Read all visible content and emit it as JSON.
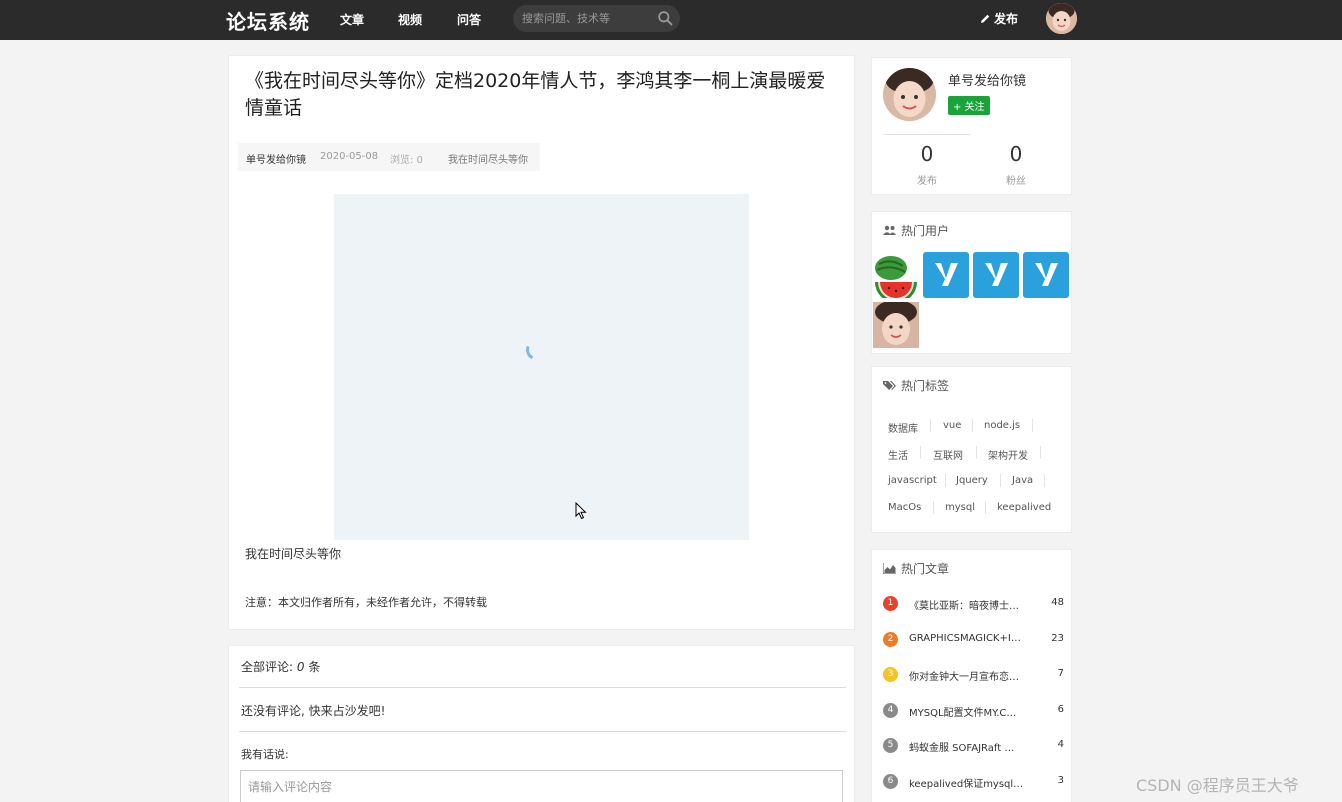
{
  "header": {
    "logo": "论坛系统",
    "nav": [
      "文章",
      "视频",
      "问答"
    ],
    "search_placeholder": "搜索问题、技术等",
    "publish_label": "发布"
  },
  "article": {
    "title": "《我在时间尽头等你》定档2020年情人节，李鸿其李一桐上演最暖爱情童话",
    "author": "单号发给你镜",
    "date": "2020-05-08",
    "views": "浏览: 0",
    "tag": "我在时间尽头等你",
    "caption": "我在时间尽头等你",
    "notice": "注意：本文归作者所有，未经作者允许，不得转载"
  },
  "comments": {
    "total_prefix": "全部评论: ",
    "total_count": "0",
    "total_suffix": " 条",
    "empty_text": "还没有评论, 快来占沙发吧!",
    "input_label": "我有话说:",
    "input_placeholder": "请输入评论内容"
  },
  "profile": {
    "name": "单号发给你镜",
    "follow_label": "+ 关注",
    "posts_count": "0",
    "posts_label": "发布",
    "fans_count": "0",
    "fans_label": "粉丝"
  },
  "hot_users": {
    "title": "热门用户"
  },
  "hot_tags": {
    "title": "热门标签",
    "tags": [
      "数据库",
      "vue",
      "node.js",
      "生活",
      "互联网",
      "架构开发",
      "javascript",
      "Jquery",
      "Java",
      "MacOs",
      "mysql",
      "keepalived"
    ]
  },
  "hot_articles": {
    "title": "热门文章",
    "items": [
      {
        "rank": "1",
        "title": "《莫比亚斯：暗夜博士…",
        "count": "48",
        "color": "#e8412c"
      },
      {
        "rank": "2",
        "title": "GRAPHICSMAGICK+I…",
        "count": "23",
        "color": "#ef7b23"
      },
      {
        "rank": "3",
        "title": "你对金钟大一月宣布恋…",
        "count": "7",
        "color": "#f4c325"
      },
      {
        "rank": "4",
        "title": "MYSQL配置文件MY.C…",
        "count": "6",
        "color": "#8a8a8a"
      },
      {
        "rank": "5",
        "title": "蚂蚁金服 SOFAJRaft …",
        "count": "4",
        "color": "#8a8a8a"
      },
      {
        "rank": "6",
        "title": "keepalived保证mysql…",
        "count": "3",
        "color": "#8a8a8a"
      }
    ]
  },
  "watermark": "CSDN @程序员王大爷"
}
